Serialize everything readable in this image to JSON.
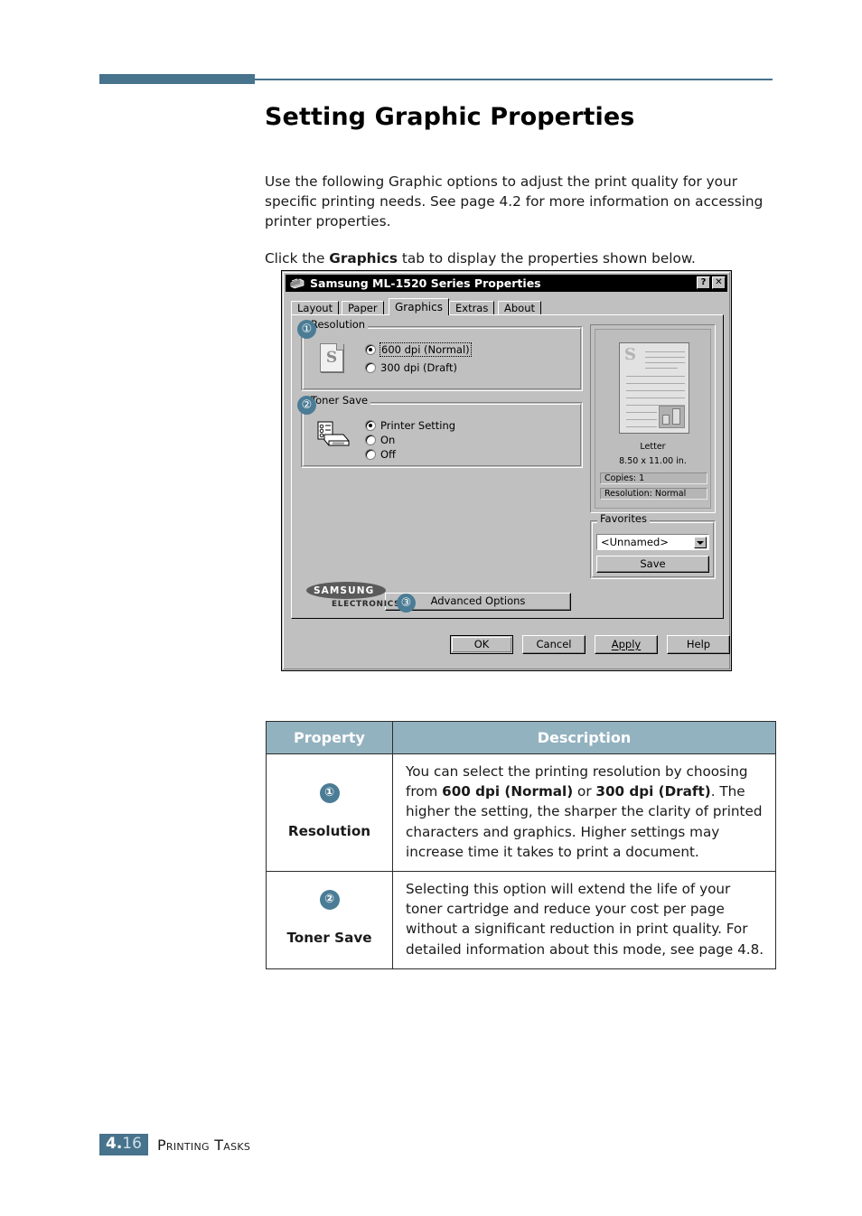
{
  "page": {
    "title": "Setting Graphic Properties",
    "intro_paragraph": "Use the following Graphic options to adjust the print quality for your specific printing needs. See page 4.2 for more information on accessing printer properties.",
    "click_prefix": "Click the ",
    "click_bold": "Graphics",
    "click_suffix": " tab to display the properties shown below."
  },
  "dialog": {
    "title": "Samsung ML-1520 Series Properties",
    "titlebar_buttons": {
      "help": "?",
      "close": "✕"
    },
    "tabs": [
      {
        "label": "Layout",
        "mnemonic": "L",
        "active": false
      },
      {
        "label": "Paper",
        "mnemonic": "P",
        "active": false
      },
      {
        "label": "Graphics",
        "mnemonic": "G",
        "active": true
      },
      {
        "label": "Extras",
        "mnemonic": "E",
        "active": false
      },
      {
        "label": "About",
        "mnemonic": "A",
        "active": false
      }
    ],
    "resolution": {
      "group_label": "Resolution",
      "callout": "①",
      "options": [
        {
          "label": "600 dpi (Normal)",
          "checked": true,
          "focused": true
        },
        {
          "label": "300 dpi (Draft)",
          "checked": false,
          "focused": false
        }
      ],
      "icon_letter": "S"
    },
    "toner_save": {
      "group_label": "Toner Save",
      "callout": "②",
      "options": [
        {
          "label": "Printer Setting",
          "checked": true
        },
        {
          "label": "On",
          "checked": false
        },
        {
          "label": "Off",
          "checked": false
        }
      ]
    },
    "preview": {
      "page_letter": "S",
      "paper_name": "Letter",
      "paper_size": "8.50 x 11.00 in.",
      "copies": "Copies: 1",
      "resolution": "Resolution:  Normal"
    },
    "favorites": {
      "group_label": "Favorites",
      "selected": "<Unnamed>",
      "save_label": "Save"
    },
    "advanced": {
      "callout": "③",
      "label": "Advanced Options"
    },
    "brand": {
      "name": "SAMSUNG",
      "subtitle": "ELECTRONICS"
    },
    "buttons": [
      {
        "label": "OK",
        "default": true
      },
      {
        "label": "Cancel",
        "default": false
      },
      {
        "label": "Apply",
        "mnemonic": "A",
        "default": false
      },
      {
        "label": "Help",
        "default": false
      }
    ]
  },
  "table": {
    "headers": {
      "property": "Property",
      "description": "Description"
    },
    "rows": [
      {
        "marker": "①",
        "property": "Resolution",
        "description_parts": [
          {
            "text": "You can select the printing resolution by choosing from ",
            "bold": false
          },
          {
            "text": "600 dpi (Normal)",
            "bold": true
          },
          {
            "text": " or ",
            "bold": false
          },
          {
            "text": "300 dpi (Draft)",
            "bold": true
          },
          {
            "text": ". The higher the setting, the sharper the clarity of printed characters and graphics. Higher settings may increase time it takes to print a document.",
            "bold": false
          }
        ]
      },
      {
        "marker": "②",
        "property": "Toner Save",
        "description_parts": [
          {
            "text": "Selecting this option will extend the life of your toner cartridge and reduce your cost per page without a significant reduction in print quality. For detailed information about this mode, see page 4.8.",
            "bold": false
          }
        ]
      }
    ]
  },
  "footer": {
    "page_major": "4.",
    "page_minor": "16",
    "section": "Printing Tasks"
  },
  "colors": {
    "accent": "#47738c",
    "callout": "#4b7c95",
    "table_header": "#93b2c0",
    "dialog_face": "#c0c0c0",
    "titlebar": "#000000"
  }
}
